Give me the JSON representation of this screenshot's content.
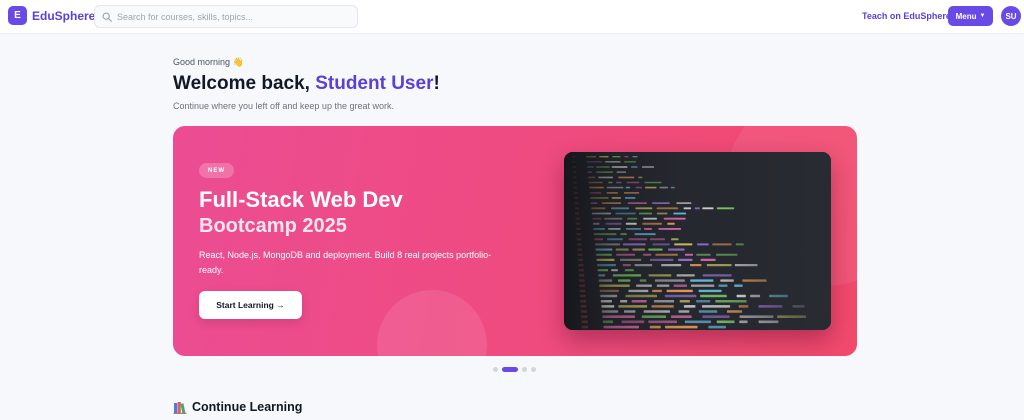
{
  "app": {
    "logo_letter": "E",
    "name": "EduSphere",
    "brand_color": "#6a4ae6"
  },
  "header": {
    "search_placeholder": "Search for courses, skills, topics...",
    "search_value": "",
    "teach_link": "Teach on EduSphere",
    "menu_label": "Menu",
    "menu_caret": "▼",
    "avatar_initials": "SU"
  },
  "greeting": {
    "small": "Good morning 👋",
    "welcome_prefix": "Welcome back, ",
    "user_name": "Student User",
    "welcome_suffix": "!",
    "subtitle": "Continue where you left off and keep up the great work."
  },
  "hero": {
    "badge": "NEW",
    "title_line1": "Full-Stack Web Dev",
    "title_line2": "Bootcamp 2025",
    "description": "React, Node.js, MongoDB and deployment. Build 8 real projects portfolio-ready.",
    "cta_label": "Start Learning →",
    "gradient_start": "#ec4c93",
    "gradient_end": "#f24a6c",
    "image_icon": "code-screen-image"
  },
  "carousel": {
    "slide_count": 4,
    "active_index": 1
  },
  "continue_section": {
    "icon": "books-icon",
    "title": "Continue Learning"
  }
}
